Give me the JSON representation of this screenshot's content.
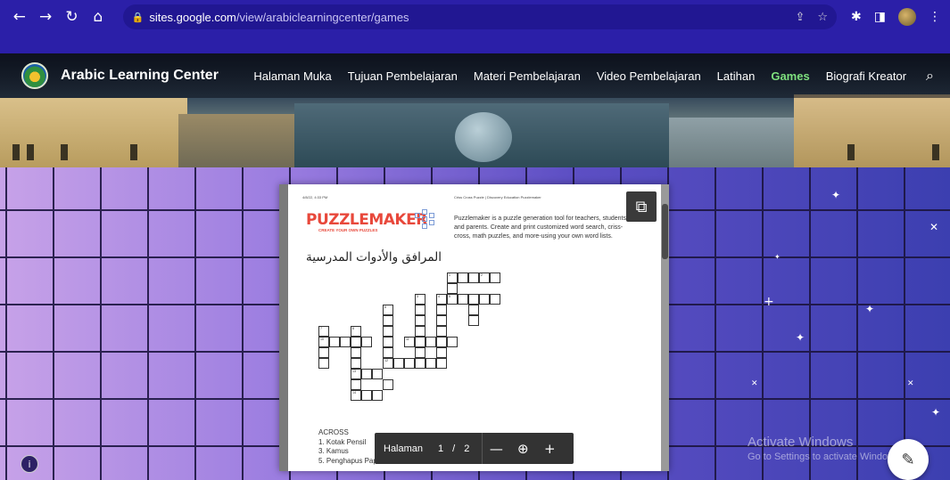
{
  "browser": {
    "url_host": "sites.google.com",
    "url_path": "/view/arabiclearningcenter/games",
    "icons": [
      "back-icon",
      "forward-icon",
      "reload-icon",
      "home-icon",
      "lock-icon",
      "share-icon",
      "bookmark-star-icon",
      "extensions-icon",
      "side-panel-icon",
      "profile-avatar",
      "menu-kebab-icon"
    ]
  },
  "site": {
    "title": "Arabic Learning Center",
    "nav": [
      {
        "label": "Halaman Muka"
      },
      {
        "label": "Tujuan Pembelajaran"
      },
      {
        "label": "Materi Pembelajaran"
      },
      {
        "label": "Video Pembelajaran"
      },
      {
        "label": "Latihan"
      },
      {
        "label": "Games",
        "active": true
      },
      {
        "label": "Biografi Kreator"
      }
    ],
    "active_color": "#7ee07e"
  },
  "pdf": {
    "header_left": "4/8/22, 4:33 PM",
    "header_right": "Criss Cross Puzzle | Discovery Education Puzzlemaker",
    "logo_text": "PUZZLEMAKER",
    "logo_sub": "CREATE YOUR OWN PUZZLES",
    "description": "Puzzlemaker is a puzzle generation tool for teachers, students and parents. Create and print customized word search, criss-cross, math puzzles, and more-using your own word lists.",
    "arabic_title": "المرافق والأدوات المدرسية",
    "across_heading": "ACROSS",
    "across_clues": [
      "1. Kotak Pensil",
      "3. Kamus",
      "5. Penghapus Papan Tulis"
    ],
    "clue_numbers": [
      "1",
      "2",
      "3",
      "4",
      "5",
      "6",
      "7",
      "8",
      "9",
      "10",
      "11",
      "12",
      "13",
      "14"
    ]
  },
  "toolbar": {
    "page_label": "Halaman",
    "current_page": "1",
    "separator": "/",
    "total_pages": "2",
    "zoom_out": "—",
    "zoom_fit": "⊕",
    "zoom_in": "+"
  },
  "watermark": {
    "title": "Activate Windows",
    "subtitle": "Go to Settings to activate Windows."
  }
}
